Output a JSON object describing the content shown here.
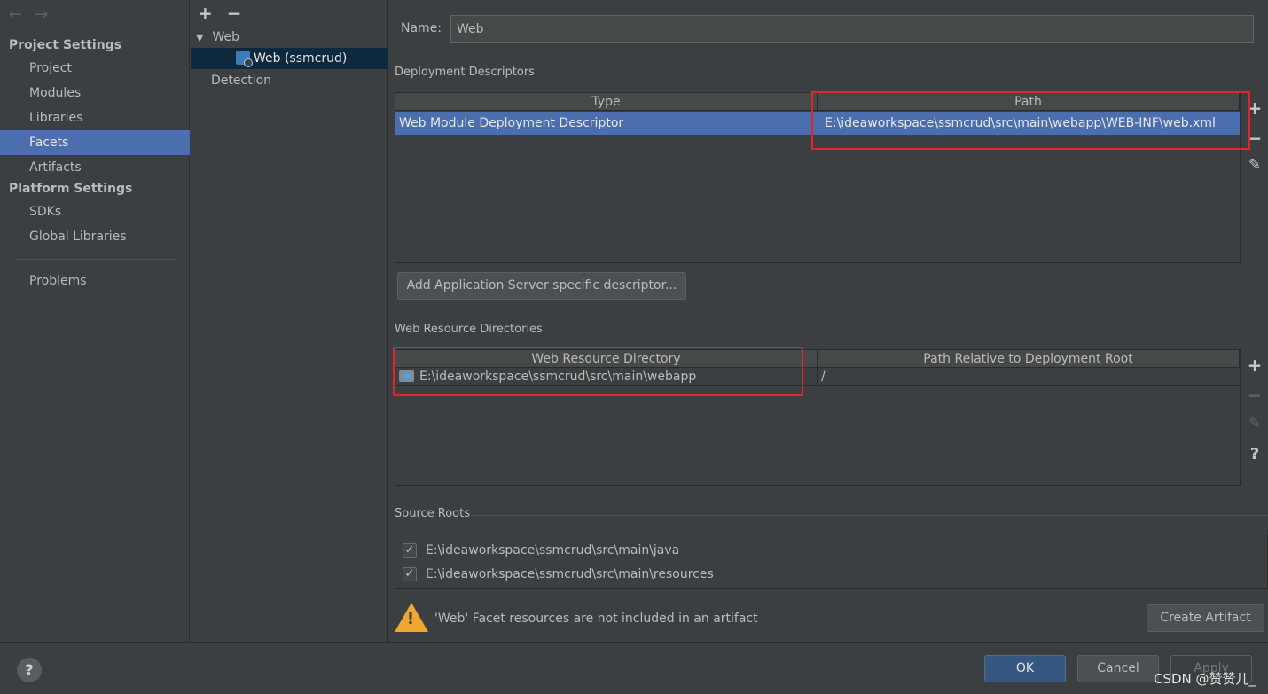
{
  "nav": {
    "back_icon": "arrow-left-icon",
    "forward_icon": "arrow-right-icon",
    "project_settings": "Project Settings",
    "project_items": [
      "Project",
      "Modules",
      "Libraries",
      "Facets",
      "Artifacts"
    ],
    "platform_settings": "Platform Settings",
    "platform_items": [
      "SDKs",
      "Global Libraries"
    ],
    "problems": "Problems",
    "selected": "Facets"
  },
  "tree": {
    "add": "+",
    "remove": "−",
    "root": "Web",
    "child": "Web (ssmcrud)",
    "detection": "Detection"
  },
  "main": {
    "name_label": "Name:",
    "name_value": "Web",
    "deployment": {
      "title": "Deployment Descriptors",
      "col_type": "Type",
      "col_path": "Path",
      "row_type": "Web Module Deployment Descriptor",
      "row_path": "E:\\ideaworkspace\\ssmcrud\\src\\main\\webapp\\WEB-INF\\web.xml",
      "add_server_btn": "Add Application Server specific descriptor..."
    },
    "resources": {
      "title": "Web Resource Directories",
      "col_dir": "Web Resource Directory",
      "col_rel": "Path Relative to Deployment Root",
      "row_dir": "E:\\ideaworkspace\\ssmcrud\\src\\main\\webapp",
      "row_rel": "/"
    },
    "tools": {
      "add": "+",
      "remove": "−",
      "help": "?"
    },
    "source_roots": {
      "title": "Source Roots",
      "items": [
        "E:\\ideaworkspace\\ssmcrud\\src\\main\\java",
        "E:\\ideaworkspace\\ssmcrud\\src\\main\\resources"
      ],
      "check": "✓"
    },
    "warning": "'Web' Facet resources are not included in an artifact",
    "warning_mark": "!",
    "create_artifact": "Create Artifact"
  },
  "bottom": {
    "help": "?",
    "ok": "OK",
    "cancel": "Cancel",
    "apply": "Apply",
    "watermark": "CSDN @赞赞儿_"
  }
}
